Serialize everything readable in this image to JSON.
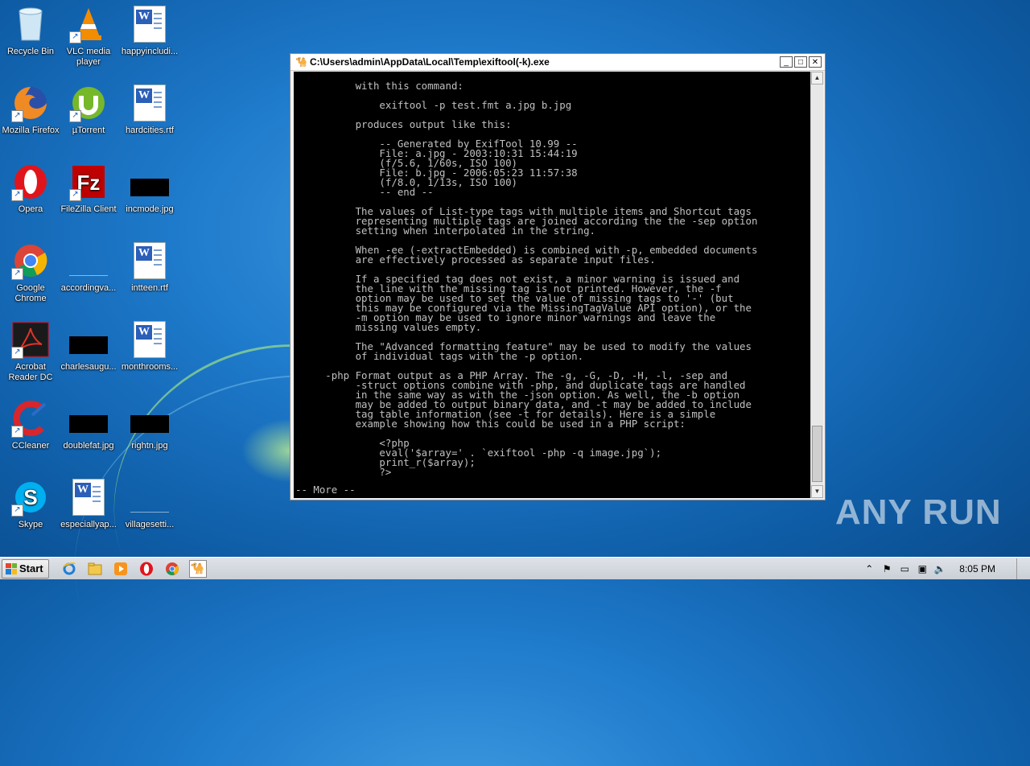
{
  "desktop": {
    "icons": [
      {
        "label": "Recycle Bin",
        "icon": "recycle-bin-icon"
      },
      {
        "label": "VLC media player",
        "icon": "vlc-icon"
      },
      {
        "label": "happyincludi...",
        "icon": "word-document-icon"
      },
      {
        "label": "Mozilla Firefox",
        "icon": "firefox-icon"
      },
      {
        "label": "µTorrent",
        "icon": "utorrent-icon"
      },
      {
        "label": "hardcities.rtf",
        "icon": "word-document-icon"
      },
      {
        "label": "Opera",
        "icon": "opera-icon"
      },
      {
        "label": "FileZilla Client",
        "icon": "filezilla-icon"
      },
      {
        "label": "incmode.jpg",
        "icon": "image-file-icon"
      },
      {
        "label": "Google Chrome",
        "icon": "chrome-icon"
      },
      {
        "label": "accordingva...",
        "icon": "image-file-icon"
      },
      {
        "label": "intteen.rtf",
        "icon": "word-document-icon"
      },
      {
        "label": "Acrobat Reader DC",
        "icon": "acrobat-icon"
      },
      {
        "label": "charlesaugu...",
        "icon": "image-file-icon"
      },
      {
        "label": "monthrooms...",
        "icon": "word-document-icon"
      },
      {
        "label": "CCleaner",
        "icon": "ccleaner-icon"
      },
      {
        "label": "doublefat.jpg",
        "icon": "image-file-icon"
      },
      {
        "label": "rightn.jpg",
        "icon": "image-file-icon"
      },
      {
        "label": "Skype",
        "icon": "skype-icon"
      },
      {
        "label": "especiallyap...",
        "icon": "word-document-icon"
      },
      {
        "label": "villagesetti...",
        "icon": "image-file-icon"
      }
    ]
  },
  "window": {
    "title": "C:\\Users\\admin\\AppData\\Local\\Temp\\exiftool(-k).exe",
    "buttons": {
      "minimize": "_",
      "maximize": "□",
      "close": "✕"
    },
    "console_text": "          with this command:\n\n              exiftool -p test.fmt a.jpg b.jpg\n\n          produces output like this:\n\n              -- Generated by ExifTool 10.99 --\n              File: a.jpg - 2003:10:31 15:44:19\n              (f/5.6, 1/60s, ISO 100)\n              File: b.jpg - 2006:05:23 11:57:38\n              (f/8.0, 1/13s, ISO 100)\n              -- end --\n\n          The values of List-type tags with multiple items and Shortcut tags\n          representing multiple tags are joined according the the -sep option\n          setting when interpolated in the string.\n\n          When -ee (-extractEmbedded) is combined with -p, embedded documents\n          are effectively processed as separate input files.\n\n          If a specified tag does not exist, a minor warning is issued and\n          the line with the missing tag is not printed. However, the -f\n          option may be used to set the value of missing tags to '-' (but\n          this may be configured via the MissingTagValue API option), or the\n          -m option may be used to ignore minor warnings and leave the\n          missing values empty.\n\n          The \"Advanced formatting feature\" may be used to modify the values\n          of individual tags with the -p option.\n\n     -php Format output as a PHP Array. The -g, -G, -D, -H, -l, -sep and\n          -struct options combine with -php, and duplicate tags are handled\n          in the same way as with the -json option. As well, the -b option\n          may be added to output binary data, and -t may be added to include\n          tag table information (see -t for details). Here is a simple\n          example showing how this could be used in a PHP script:\n\n              <?php\n              eval('$array=' . `exiftool -php -q image.jpg`);\n              print_r($array);\n              ?>",
    "more_prompt": "-- More  --"
  },
  "watermark": "ANY RUN",
  "taskbar": {
    "start_label": "Start",
    "pinned": [
      "internet-explorer-icon",
      "file-explorer-icon",
      "media-player-icon",
      "opera-icon",
      "chrome-icon",
      "exiftool-icon"
    ],
    "clock": "8:05 PM"
  }
}
